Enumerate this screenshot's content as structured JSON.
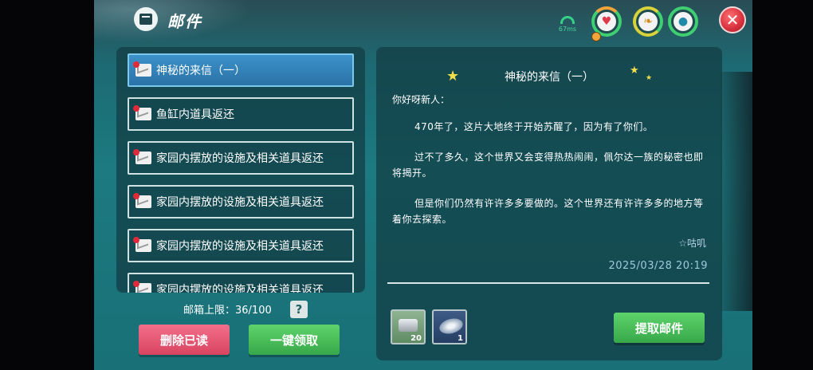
{
  "header": {
    "title": "邮件",
    "ping": "67ms",
    "close_label": "✕"
  },
  "status_icons": [
    "heart-icon",
    "food-icon",
    "water-drop-icon"
  ],
  "mail_list": {
    "items": [
      {
        "label": "神秘的来信（一）",
        "selected": true
      },
      {
        "label": "鱼缸内道具返还",
        "selected": false
      },
      {
        "label": "家园内摆放的设施及相关道具返还",
        "selected": false
      },
      {
        "label": "家园内摆放的设施及相关道具返还",
        "selected": false
      },
      {
        "label": "家园内摆放的设施及相关道具返还",
        "selected": false
      },
      {
        "label": "家园内摆放的设施及相关道具返还",
        "selected": false
      }
    ],
    "capacity_label": "邮箱上限：36/100",
    "help_label": "?"
  },
  "buttons": {
    "delete_read": "删除已读",
    "claim_all": "一键领取",
    "claim_mail": "提取邮件"
  },
  "detail": {
    "title": "神秘的来信（一）",
    "greeting": "你好呀新人：",
    "paragraphs": [
      "470年了，这片大地终于开始苏醒了，因为有了你们。",
      "过不了多久，这个世界又会变得热热闹闹，佩尔达一族的秘密也即将揭开。",
      "但是你们仍然有许许多多要做的。这个世界还有许许多多的地方等着你去探索。"
    ],
    "signature": "☆咕叽",
    "timestamp": "2025/03/28 20:19"
  },
  "attachments": [
    {
      "icon": "silver-ingot-icon",
      "count": "20"
    },
    {
      "icon": "disc-item-icon",
      "count": "1"
    }
  ]
}
